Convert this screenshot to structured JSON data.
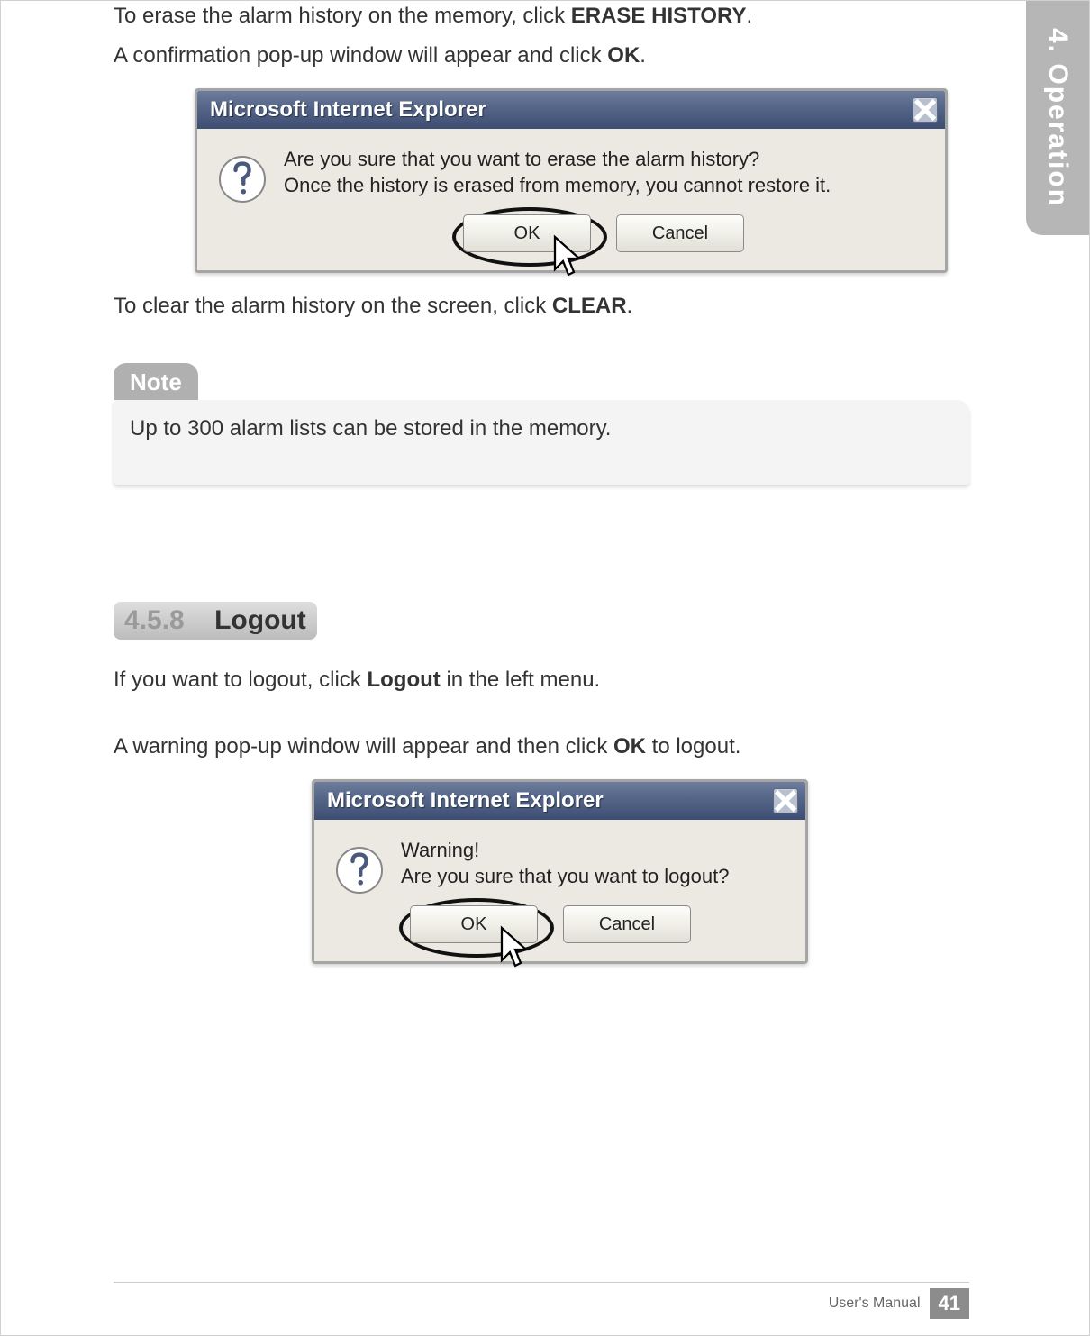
{
  "side_tab": "4. Operation",
  "intro": {
    "p1a": "To erase the alarm history on the memory, click ",
    "p1b": "ERASE HISTORY",
    "p1c": ".",
    "p2a": "A confirmation pop-up window will appear and click ",
    "p2b": "OK",
    "p2c": "."
  },
  "dialog1": {
    "title": "Microsoft Internet Explorer",
    "line1": "Are you sure that you want to erase the alarm history?",
    "line2": " Once the history is erased from memory, you cannot restore it.",
    "ok": "OK",
    "cancel": "Cancel"
  },
  "after1": {
    "a": "To clear the alarm history on the screen, click ",
    "b": "CLEAR",
    "c": "."
  },
  "note": {
    "label": "Note",
    "text": "Up to 300 alarm lists can be stored in the memory."
  },
  "section": {
    "num": "4.5.8",
    "title": "Logout"
  },
  "logout": {
    "p1a": "If you want to logout, click ",
    "p1b": "Logout",
    "p1c": " in the left menu.",
    "p2a": "A warning pop-up window will appear and then click ",
    "p2b": "OK",
    "p2c": " to logout."
  },
  "dialog2": {
    "title": "Microsoft Internet Explorer",
    "line1": "Warning!",
    "line2": "Are you sure that you want to logout?",
    "ok": "OK",
    "cancel": "Cancel"
  },
  "footer": {
    "text": "User's Manual",
    "page": "41"
  }
}
